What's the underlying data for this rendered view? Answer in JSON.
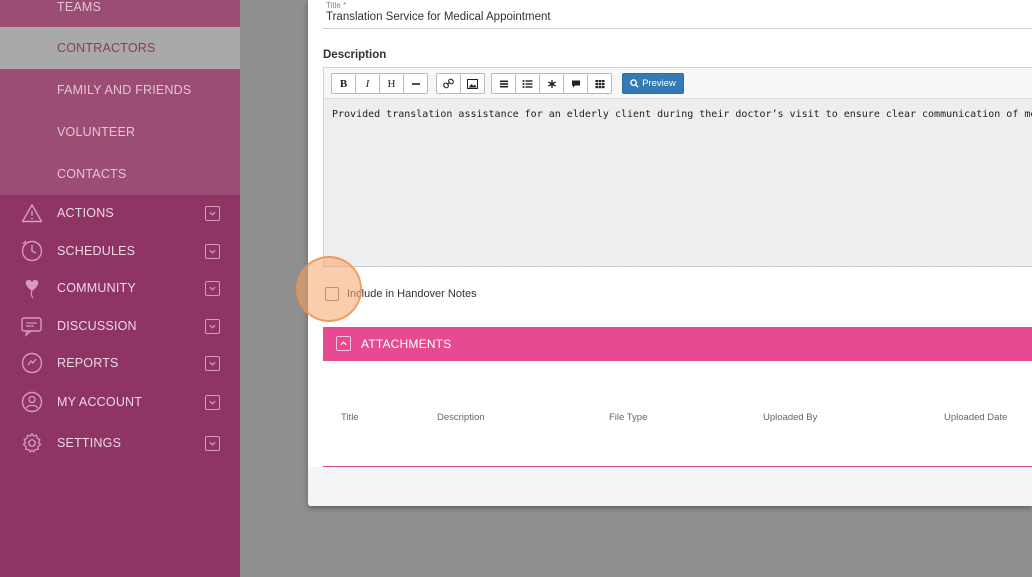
{
  "sidebar": {
    "sub_items": [
      {
        "label": "TEAMS"
      },
      {
        "label": "CONTRACTORS"
      },
      {
        "label": "FAMILY AND FRIENDS"
      },
      {
        "label": "VOLUNTEER"
      },
      {
        "label": "CONTACTS"
      }
    ],
    "items": [
      {
        "label": "ACTIONS",
        "icon": "warning-icon"
      },
      {
        "label": "SCHEDULES",
        "icon": "clock-icon"
      },
      {
        "label": "COMMUNITY",
        "icon": "heart-balloon-icon"
      },
      {
        "label": "DISCUSSION",
        "icon": "chat-icon"
      },
      {
        "label": "REPORTS",
        "icon": "report-icon"
      },
      {
        "label": "MY ACCOUNT",
        "icon": "user-icon"
      },
      {
        "label": "SETTINGS",
        "icon": "gear-icon"
      }
    ]
  },
  "form": {
    "title_label": "Title *",
    "title_value": "Translation Service for Medical Appointment",
    "description_label": "Description",
    "description_text": "Provided translation assistance for an elderly client during their doctor’s visit to ensure clear communication of medical",
    "toolbar": {
      "bold": "B",
      "italic": "I",
      "heading": "H",
      "preview_label": "Preview"
    },
    "handover_label": "Include in Handover Notes"
  },
  "attachments": {
    "title": "ATTACHMENTS",
    "columns": [
      "Title",
      "Description",
      "File Type",
      "Uploaded By",
      "Uploaded Date"
    ]
  },
  "colors": {
    "sidebar": "#8e3565",
    "accent": "#e64b91",
    "preview_button": "#337ab7"
  }
}
